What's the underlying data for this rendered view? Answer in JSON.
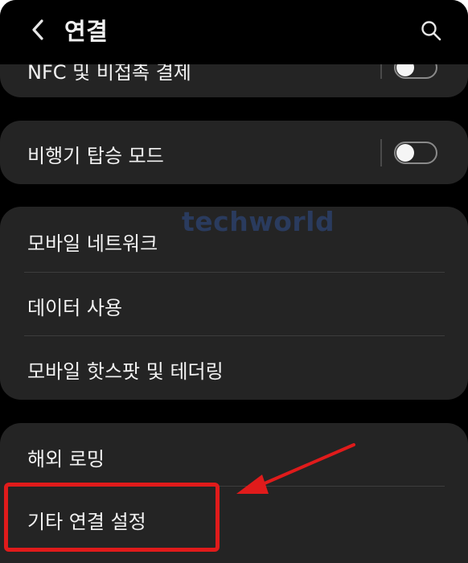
{
  "header": {
    "title": "연결",
    "back_icon": "chevron-left-icon",
    "search_icon": "search-icon"
  },
  "items": {
    "nfc": {
      "label": "NFC 및 비접촉 결제",
      "toggle_on": false
    },
    "airplane": {
      "label": "비행기 탑승 모드",
      "toggle_on": false
    },
    "mobile_network": {
      "label": "모바일 네트워크"
    },
    "data_usage": {
      "label": "데이터 사용"
    },
    "hotspot": {
      "label": "모바일 핫스팟 및 테더링"
    },
    "roaming": {
      "label": "해외 로밍"
    },
    "more": {
      "label": "기타 연결 설정"
    }
  },
  "watermark": {
    "text": "techworld"
  },
  "colors": {
    "background": "#000000",
    "card": "#242424",
    "text": "#f2f2f2",
    "highlight": "#e01b1b",
    "watermark": "#2a3b5e"
  }
}
